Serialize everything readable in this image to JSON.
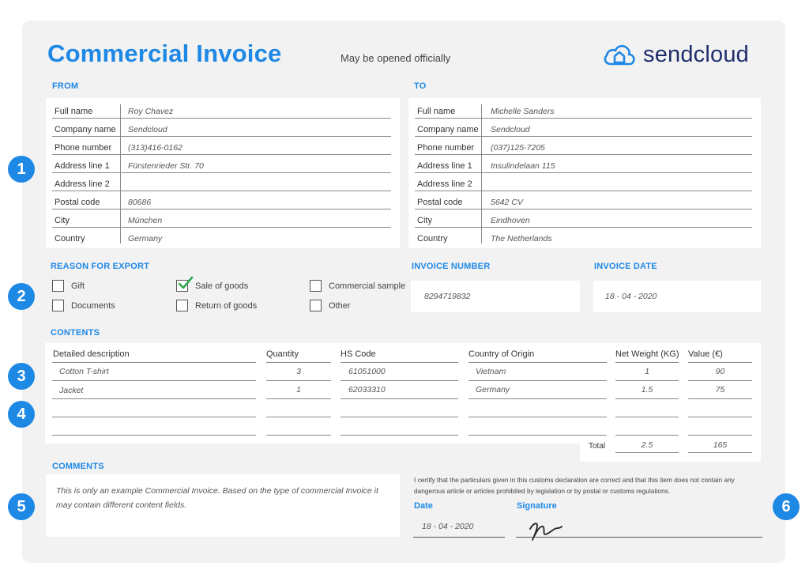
{
  "header": {
    "title": "Commercial Invoice",
    "subtitle": "May be opened officially",
    "brand": "sendcloud"
  },
  "from": {
    "heading": "FROM",
    "rows": [
      {
        "label": "Full name",
        "value": "Roy Chavez"
      },
      {
        "label": "Company name",
        "value": "Sendcloud"
      },
      {
        "label": "Phone number",
        "value": "(313)416-0162"
      },
      {
        "label": "Address line 1",
        "value": "Fürstenrieder Str. 70"
      },
      {
        "label": "Address line 2",
        "value": ""
      },
      {
        "label": "Postal code",
        "value": "80686"
      },
      {
        "label": "City",
        "value": "München"
      },
      {
        "label": "Country",
        "value": "Germany"
      }
    ]
  },
  "to": {
    "heading": "TO",
    "rows": [
      {
        "label": "Full name",
        "value": "Michelle Sanders"
      },
      {
        "label": "Company name",
        "value": "Sendcloud"
      },
      {
        "label": "Phone number",
        "value": "(037)125-7205"
      },
      {
        "label": "Address line 1",
        "value": "Insulindelaan 115"
      },
      {
        "label": "Address line 2",
        "value": ""
      },
      {
        "label": "Postal code",
        "value": "5642 CV"
      },
      {
        "label": "City",
        "value": "Eindhoven"
      },
      {
        "label": "Country",
        "value": "The Netherlands"
      }
    ]
  },
  "reason": {
    "heading": "REASON FOR EXPORT",
    "options": [
      {
        "label": "Gift",
        "checked": false
      },
      {
        "label": "Sale of goods",
        "checked": true
      },
      {
        "label": "Commercial sample",
        "checked": false
      },
      {
        "label": "Documents",
        "checked": false
      },
      {
        "label": "Return of goods",
        "checked": false
      },
      {
        "label": "Other",
        "checked": false
      }
    ]
  },
  "invoice_number": {
    "heading": "INVOICE NUMBER",
    "value": "8294719832"
  },
  "invoice_date": {
    "heading": "INVOICE DATE",
    "value": "18 - 04 - 2020"
  },
  "contents": {
    "heading": "CONTENTS",
    "columns": [
      "Detailed description",
      "Quantity",
      "HS Code",
      "Country of Origin",
      "Net Weight (KG)",
      "Value (€)"
    ],
    "rows": [
      {
        "description": "Cotton T-shirt",
        "quantity": "3",
        "hs_code": "61051000",
        "origin": "Vietnam",
        "weight": "1",
        "value": "90"
      },
      {
        "description": "Jacket",
        "quantity": "1",
        "hs_code": "62033310",
        "origin": "Germany",
        "weight": "1.5",
        "value": "75"
      }
    ],
    "total_label": "Total",
    "total_weight": "2.5",
    "total_value": "165"
  },
  "comments": {
    "heading": "COMMENTS",
    "text": "This is only an example Commercial Invoice. Based on the type of commercial Invoice it may contain different content fields."
  },
  "certification": {
    "text": "I certify that the particulars given in this customs declaration are correct and that this item does not contain any dangerous article or articles prohibited by legislation or by postal or customs regulations.",
    "date_label": "Date",
    "date_value": "18 - 04 - 2020",
    "signature_label": "Signature"
  },
  "badges": [
    "1",
    "2",
    "3",
    "4",
    "5",
    "6"
  ],
  "colors": {
    "accent": "#1e88e5",
    "brand_text": "#1f2d6b",
    "card_bg": "#f2f2f3",
    "check": "#2fa84f"
  }
}
